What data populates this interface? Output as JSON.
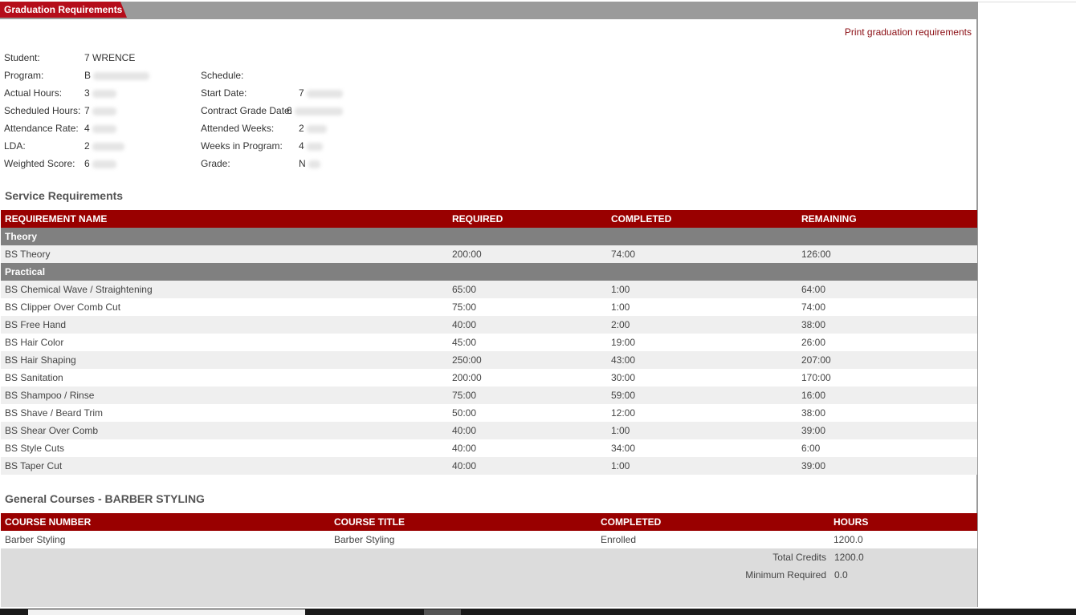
{
  "panel": {
    "title": "Graduation Requirements",
    "print_link": "Print graduation requirements"
  },
  "student_info": {
    "student_label": "Student:",
    "student_value": "7 WRENCE",
    "program_label": "Program:",
    "program_value": "B",
    "schedule_label": "Schedule:",
    "schedule_value": "",
    "actual_hours_label": "Actual Hours:",
    "actual_hours_value": "3",
    "start_date_label": "Start Date:",
    "start_date_value": "7",
    "scheduled_hours_label": "Scheduled Hours:",
    "scheduled_hours_value": "7",
    "contract_grade_date_label": "Contract Grade Date:",
    "contract_grade_date_value": "6",
    "attendance_rate_label": "Attendance Rate:",
    "attendance_rate_value": "4",
    "attended_weeks_label": "Attended Weeks:",
    "attended_weeks_value": "2",
    "lda_label": "LDA:",
    "lda_value": "2",
    "weeks_in_program_label": "Weeks in Program:",
    "weeks_in_program_value": "4",
    "weighted_score_label": "Weighted Score:",
    "weighted_score_value": "6",
    "grade_label": "Grade:",
    "grade_value": "N"
  },
  "service": {
    "title": "Service Requirements",
    "headers": [
      "REQUIREMENT NAME",
      "REQUIRED",
      "COMPLETED",
      "REMAINING"
    ],
    "groups": [
      {
        "name": "Theory",
        "rows": [
          [
            "BS Theory",
            "200:00",
            "74:00",
            "126:00"
          ]
        ]
      },
      {
        "name": "Practical",
        "rows": [
          [
            "BS Chemical Wave / Straightening",
            "65:00",
            "1:00",
            "64:00"
          ],
          [
            "BS Clipper Over Comb Cut",
            "75:00",
            "1:00",
            "74:00"
          ],
          [
            "BS Free Hand",
            "40:00",
            "2:00",
            "38:00"
          ],
          [
            "BS Hair Color",
            "45:00",
            "19:00",
            "26:00"
          ],
          [
            "BS Hair Shaping",
            "250:00",
            "43:00",
            "207:00"
          ],
          [
            "BS Sanitation",
            "200:00",
            "30:00",
            "170:00"
          ],
          [
            "BS Shampoo / Rinse",
            "75:00",
            "59:00",
            "16:00"
          ],
          [
            "BS Shave / Beard Trim",
            "50:00",
            "12:00",
            "38:00"
          ],
          [
            "BS Shear Over Comb",
            "40:00",
            "1:00",
            "39:00"
          ],
          [
            "BS Style Cuts",
            "40:00",
            "34:00",
            "6:00"
          ],
          [
            "BS Taper Cut",
            "40:00",
            "1:00",
            "39:00"
          ]
        ]
      }
    ]
  },
  "courses": {
    "title": "General Courses - BARBER STYLING",
    "headers": [
      "COURSE NUMBER",
      "COURSE TITLE",
      "COMPLETED",
      "HOURS"
    ],
    "rows": [
      [
        "Barber Styling",
        "Barber Styling",
        "Enrolled",
        "1200.0"
      ]
    ],
    "total_credits_label": "Total Credits",
    "total_credits_value": "1200.0",
    "minimum_required_label": "Minimum Required",
    "minimum_required_value": "0.0"
  }
}
